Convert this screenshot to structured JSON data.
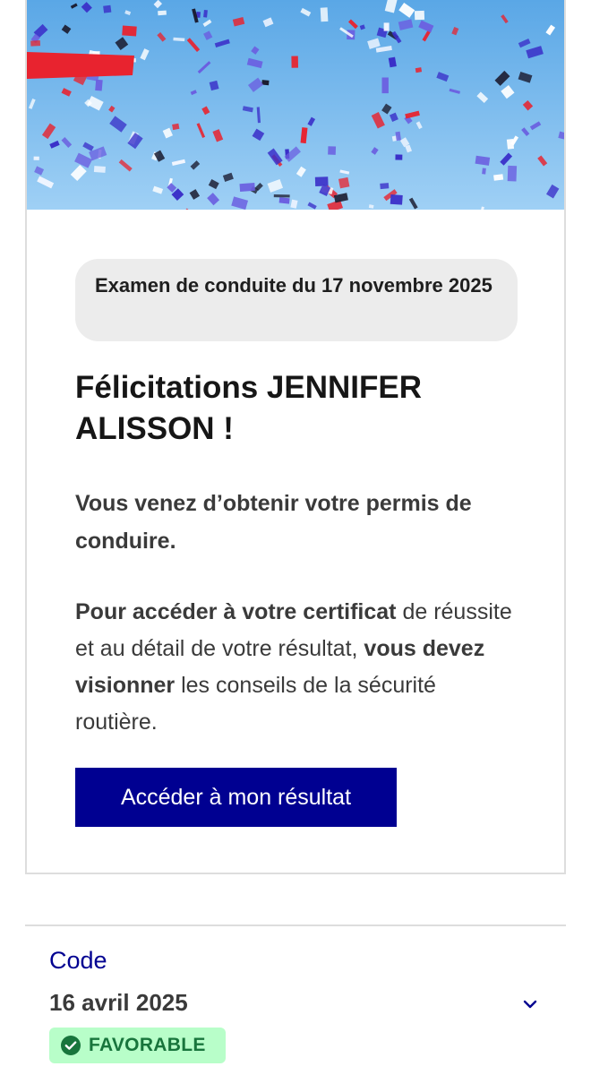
{
  "result_card": {
    "exam_pill": "Examen de conduite du 17 novembre 2025",
    "title": "Félicitations JENNIFER ALISSON !",
    "message": "Vous venez d’obtenir votre permis de conduire.",
    "instructions": {
      "bold_1": "Pour accéder à votre certificat",
      "text_1": " de réussite et au détail de votre résultat, ",
      "bold_2": "vous devez visionner",
      "text_2": " les conseils de la sécurité routière."
    },
    "cta_label": "Accéder à mon résultat"
  },
  "history": {
    "items": [
      {
        "type": "Code",
        "date": "16 avril 2025",
        "status": "FAVORABLE",
        "status_icon": "check-circle-icon",
        "expand_icon": "chevron-down-icon"
      }
    ]
  },
  "colors": {
    "primary": "#000091",
    "success_bg": "#b8fec9",
    "success_text": "#18753c",
    "sky": "#7bbdec"
  }
}
